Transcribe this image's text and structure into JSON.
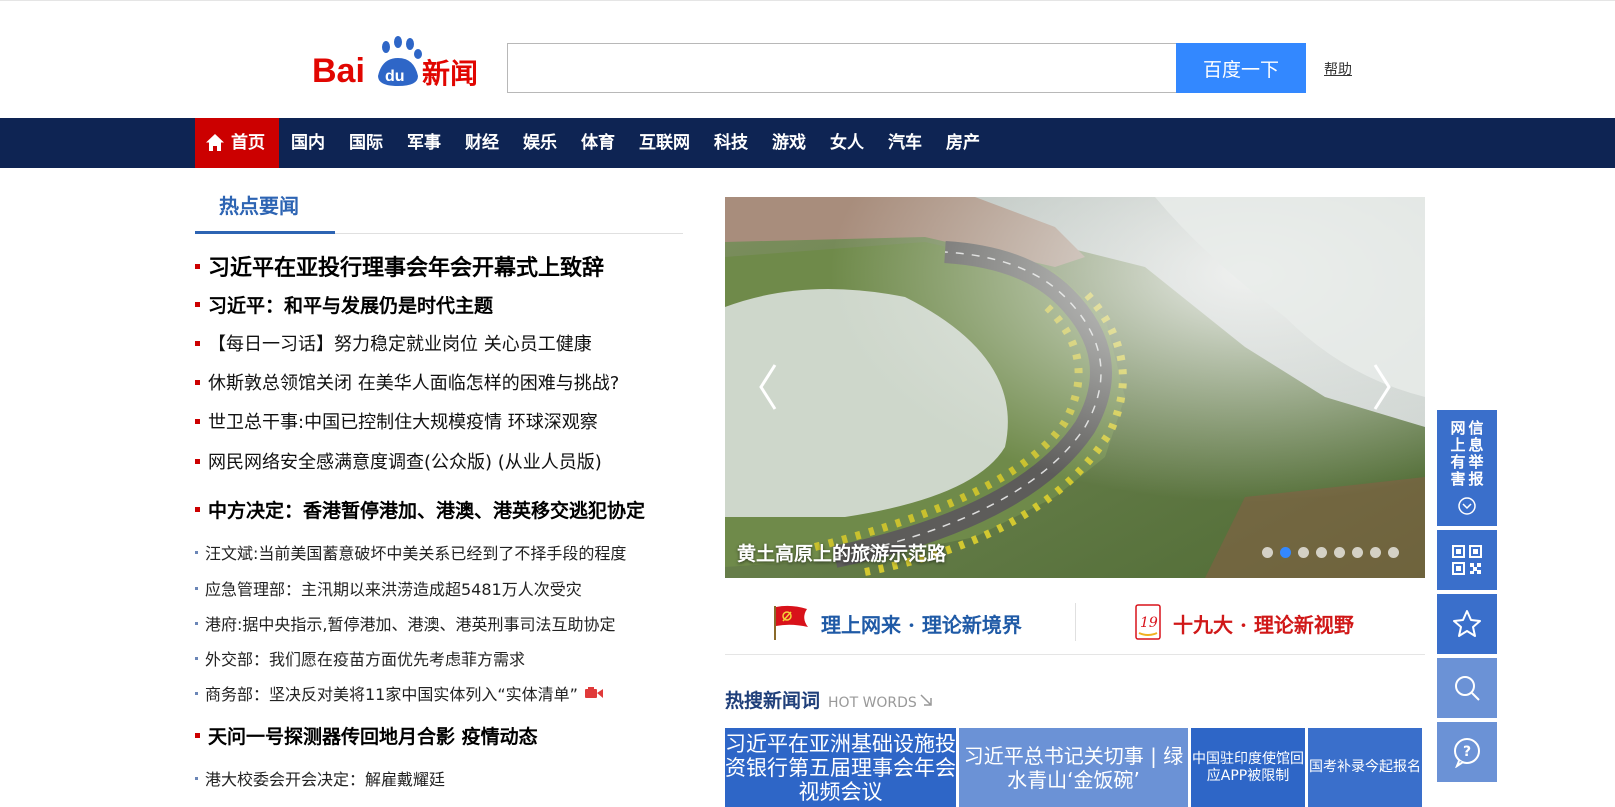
{
  "header": {
    "logo_text": "Bai du 新闻",
    "search_placeholder": "",
    "search_value": "",
    "search_button": "百度一下",
    "help_link": "帮助"
  },
  "nav": {
    "items": [
      {
        "label": "首页",
        "active": true
      },
      {
        "label": "国内"
      },
      {
        "label": "国际"
      },
      {
        "label": "军事"
      },
      {
        "label": "财经"
      },
      {
        "label": "娱乐"
      },
      {
        "label": "体育"
      },
      {
        "label": "互联网"
      },
      {
        "label": "科技"
      },
      {
        "label": "游戏"
      },
      {
        "label": "女人"
      },
      {
        "label": "汽车"
      },
      {
        "label": "房产"
      }
    ]
  },
  "hot_news": {
    "title": "热点要闻",
    "items": [
      "习近平在亚投行理事会年会开幕式上致辞",
      "习近平：和平与发展仍是时代主题",
      "【每日一习话】努力稳定就业岗位 关心员工健康",
      "休斯敦总领馆关闭 在美华人面临怎样的困难与挑战?",
      "世卫总干事:中国已控制住大规模疫情 环球深观察",
      "网民网络安全感满意度调查(公众版)  (从业人员版)",
      "中方决定：香港暂停港加、港澳、港英移交逃犯协定",
      "汪文斌:当前美国蓄意破坏中美关系已经到了不择手段的程度",
      "应急管理部：主汛期以来洪涝造成超5481万人次受灾",
      "港府:据中央指示,暂停港加、港澳、港英刑事司法互助协定",
      "外交部：我们愿在疫苗方面优先考虑菲方需求",
      "商务部：坚决反对美将11家中国实体列入“实体清单”",
      "天问一号探测器传回地月合影 疫情动态",
      "港大校委会开会决定：解雇戴耀廷"
    ]
  },
  "carousel": {
    "caption": "黄土高原上的旅游示范路",
    "slide_count": 8,
    "active_index": 1
  },
  "promos": {
    "left": "理上网来 · 理论新境界",
    "right": "十九大 · 理论新视野",
    "right_badge": "19"
  },
  "hot_words": {
    "title_cn": "热搜新闻词",
    "title_en": "HOT WORDS",
    "items": [
      "习近平在亚洲基础设施投资银行第五届理事会年会视频会议",
      "习近平总书记关切事 | 绿水青山‘金饭碗’",
      "中国驻印度使馆回应APP被限制",
      "国考补录今起报名"
    ]
  },
  "side_tools": {
    "report_label": "网上有害信息举报",
    "report_chars": [
      "网",
      "信",
      "上",
      "息",
      "有",
      "举",
      "害",
      "报"
    ]
  },
  "colors": {
    "nav_bg": "#0e2453",
    "active_red": "#cc0000",
    "search_blue": "#3388ff",
    "section_blue": "#2d64b3",
    "side_blue": "#3a6fcb"
  }
}
